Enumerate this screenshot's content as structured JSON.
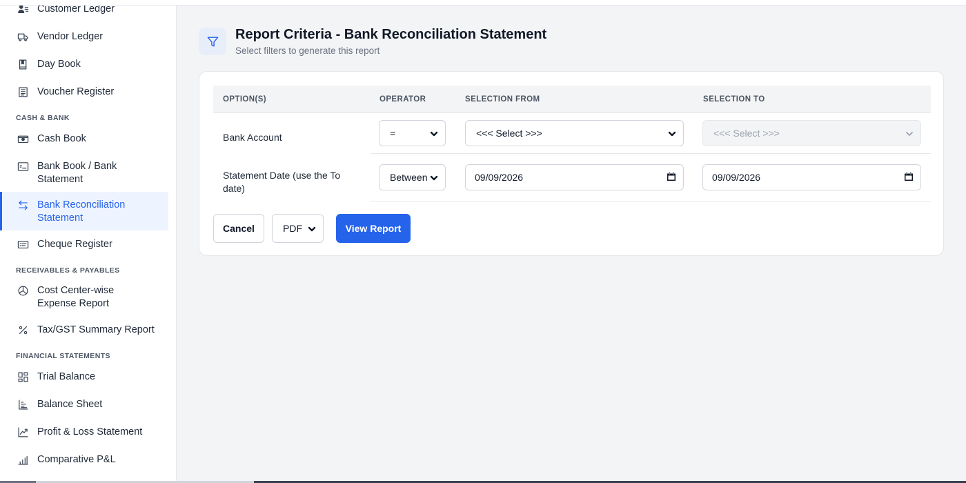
{
  "sidebar": {
    "items": [
      {
        "label": "Customer Ledger",
        "icon": "customer-ledger-icon"
      },
      {
        "label": "Vendor Ledger",
        "icon": "truck-icon"
      },
      {
        "label": "Day Book",
        "icon": "book-icon"
      },
      {
        "label": "Voucher Register",
        "icon": "register-icon"
      },
      {
        "label": "Cash Book",
        "icon": "cash-icon"
      },
      {
        "label": "Bank Book / Bank Statement",
        "icon": "bank-statement-icon"
      },
      {
        "label": "Bank Reconciliation Statement",
        "icon": "arrows-swap-icon"
      },
      {
        "label": "Cheque Register",
        "icon": "cheque-icon"
      },
      {
        "label": "Cost Center-wise Expense Report",
        "icon": "pie-chart-icon"
      },
      {
        "label": "Tax/GST Summary Report",
        "icon": "percent-icon"
      },
      {
        "label": "Trial Balance",
        "icon": "grid-layout-icon"
      },
      {
        "label": "Balance Sheet",
        "icon": "bar-list-icon"
      },
      {
        "label": "Profit & Loss Statement",
        "icon": "trend-up-icon"
      },
      {
        "label": "Comparative P&L",
        "icon": "bar-chart-icon"
      }
    ],
    "sections": [
      "CASH & BANK",
      "RECEIVABLES & PAYABLES",
      "FINANCIAL STATEMENTS"
    ],
    "active_item": "Bank Reconciliation Statement"
  },
  "header": {
    "icon": "filter-icon",
    "title": "Report Criteria - Bank Reconciliation Statement",
    "subtitle": "Select filters to generate this report"
  },
  "criteria": {
    "columns": [
      "OPTION(S)",
      "OPERATOR",
      "SELECTION FROM",
      "SELECTION TO"
    ],
    "rows": [
      {
        "option": "Bank Account",
        "operator": "=",
        "from": "<<< Select >>>",
        "to": "<<< Select >>>"
      },
      {
        "option": "Statement Date (use the To date)",
        "operator": "Between",
        "from": "09/09/2026",
        "to": "09/09/2026"
      }
    ]
  },
  "actions": {
    "cancel_label": "Cancel",
    "format": "PDF",
    "view_label": "View Report"
  },
  "colors": {
    "accent": "#2563eb",
    "active_bg": "#eef4ff",
    "page_bg": "#f3f4f6"
  }
}
